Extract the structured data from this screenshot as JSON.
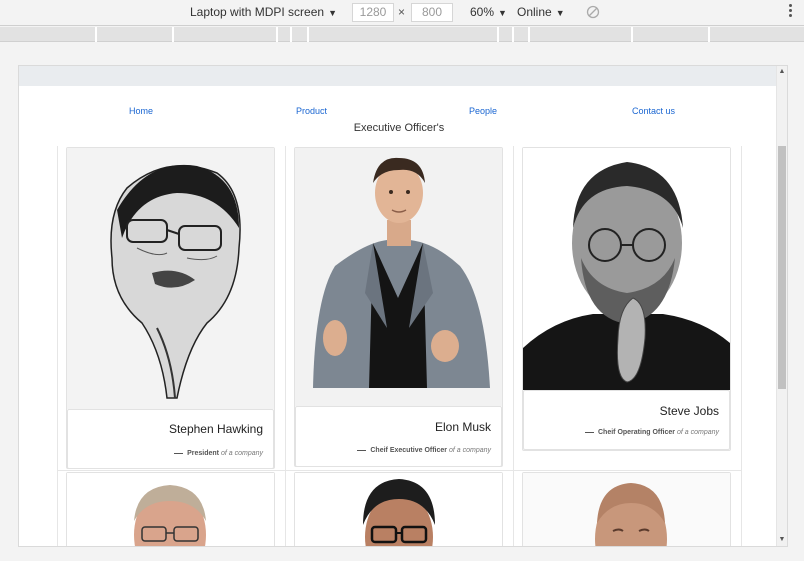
{
  "device_toolbar": {
    "device": "Laptop with MDPI screen",
    "width": "1280",
    "height": "800",
    "separator": "×",
    "zoom": "60%",
    "network": "Online"
  },
  "nav": {
    "items": [
      "Home",
      "Product",
      "People",
      "Contact us"
    ]
  },
  "page": {
    "title": "Executive Officer's"
  },
  "people": [
    {
      "name": "Stephen Hawking",
      "role": "President",
      "suffix": "of a company"
    },
    {
      "name": "Elon Musk",
      "role": "Cheif Executive Officer",
      "suffix": "of a company"
    },
    {
      "name": "Steve Jobs",
      "role": "Cheif Operating Officer",
      "suffix": "of a company"
    }
  ],
  "colors": {
    "link": "#1a66d2",
    "viewport_bar": "#e9ecef"
  }
}
